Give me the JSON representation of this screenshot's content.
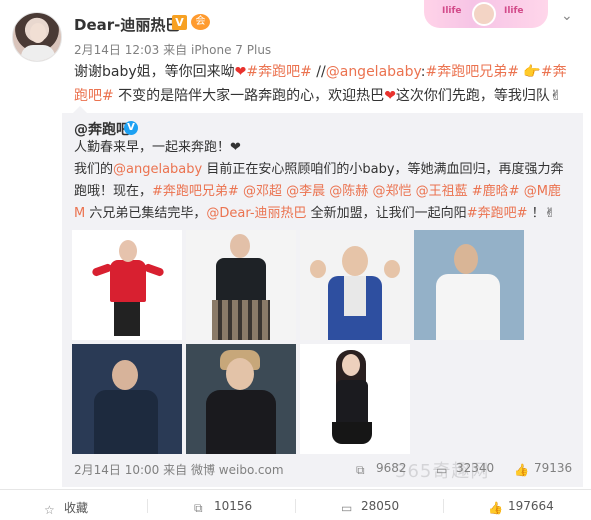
{
  "user": {
    "name": "Dear-迪丽热巴",
    "verified_badge": "V",
    "member_badge": "会"
  },
  "banner": {
    "left_text": "Ilife",
    "right_text": "Ilife"
  },
  "meta": {
    "date_time": "2月14日 12:03",
    "source_prefix": "来自",
    "source": "iPhone 7 Plus"
  },
  "post": {
    "segments": [
      {
        "text": "谢谢baby姐，等你回来呦",
        "link": false
      },
      {
        "text": "❤",
        "link": false,
        "heart": true
      },
      {
        "text": "#奔跑吧#",
        "link": true
      },
      {
        "text": " //",
        "link": false
      },
      {
        "text": "@angelababy",
        "link": true
      },
      {
        "text": ":",
        "link": false
      },
      {
        "text": "#奔跑吧兄弟#",
        "link": true
      },
      {
        "text": " 👉",
        "link": false
      },
      {
        "text": "#奔跑吧#",
        "link": true
      },
      {
        "text": " 不变的是陪伴大家一路奔跑的心，欢迎热巴",
        "link": false
      },
      {
        "text": "❤",
        "link": false,
        "heart": true
      },
      {
        "text": "这次你们先跑，等我归队✌",
        "link": false
      }
    ]
  },
  "repost": {
    "author": "@奔跑吧",
    "author_badge": "V",
    "line1": "人勤春来早，一起来奔跑！❤",
    "segments": [
      {
        "text": "我们的",
        "link": false
      },
      {
        "text": "@angelababy",
        "link": true
      },
      {
        "text": " 目前正在安心照顾咱们的小baby，等她满血回归，再度强力奔跑哦！",
        "link": false
      },
      {
        "text": "现在，",
        "link": false
      },
      {
        "text": "#奔跑吧兄弟#",
        "link": true
      },
      {
        "text": " ",
        "link": false
      },
      {
        "text": "@邓超",
        "link": true
      },
      {
        "text": " ",
        "link": false
      },
      {
        "text": "@李晨",
        "link": true
      },
      {
        "text": " ",
        "link": false
      },
      {
        "text": "@陈赫",
        "link": true
      },
      {
        "text": " ",
        "link": false
      },
      {
        "text": "@郑恺",
        "link": true
      },
      {
        "text": " ",
        "link": false
      },
      {
        "text": "@王祖藍",
        "link": true
      },
      {
        "text": " ",
        "link": false
      },
      {
        "text": "#鹿晗#",
        "link": true
      },
      {
        "text": " ",
        "link": false
      },
      {
        "text": "@M鹿M",
        "link": true
      },
      {
        "text": " 六兄弟已集结完毕，",
        "link": false
      },
      {
        "text": "@Dear-迪丽热巴",
        "link": true
      },
      {
        "text": " 全新加盟，让我们一起向阳",
        "link": false
      },
      {
        "text": "#奔跑吧#",
        "link": true
      },
      {
        "text": " ！✌",
        "link": false
      }
    ],
    "footer": {
      "date_time": "2月14日 10:00",
      "source_prefix": "来自",
      "source": "微博 weibo.com"
    },
    "shares": "9682",
    "comments": "32340",
    "likes": "79136"
  },
  "watermark": "365奇趣网",
  "actions": {
    "favorite": "收藏",
    "share_count": "10156",
    "comment_count": "28050",
    "like_count": "197664"
  },
  "icons": [
    "chevron-down-icon",
    "favorite-icon",
    "share-icon",
    "comment-icon",
    "like-icon"
  ],
  "colors": {
    "link": "#eb7350",
    "repost_bg": "#f2f2f5",
    "verified_orange": "#f7a123",
    "verified_blue": "#1da1f2"
  }
}
